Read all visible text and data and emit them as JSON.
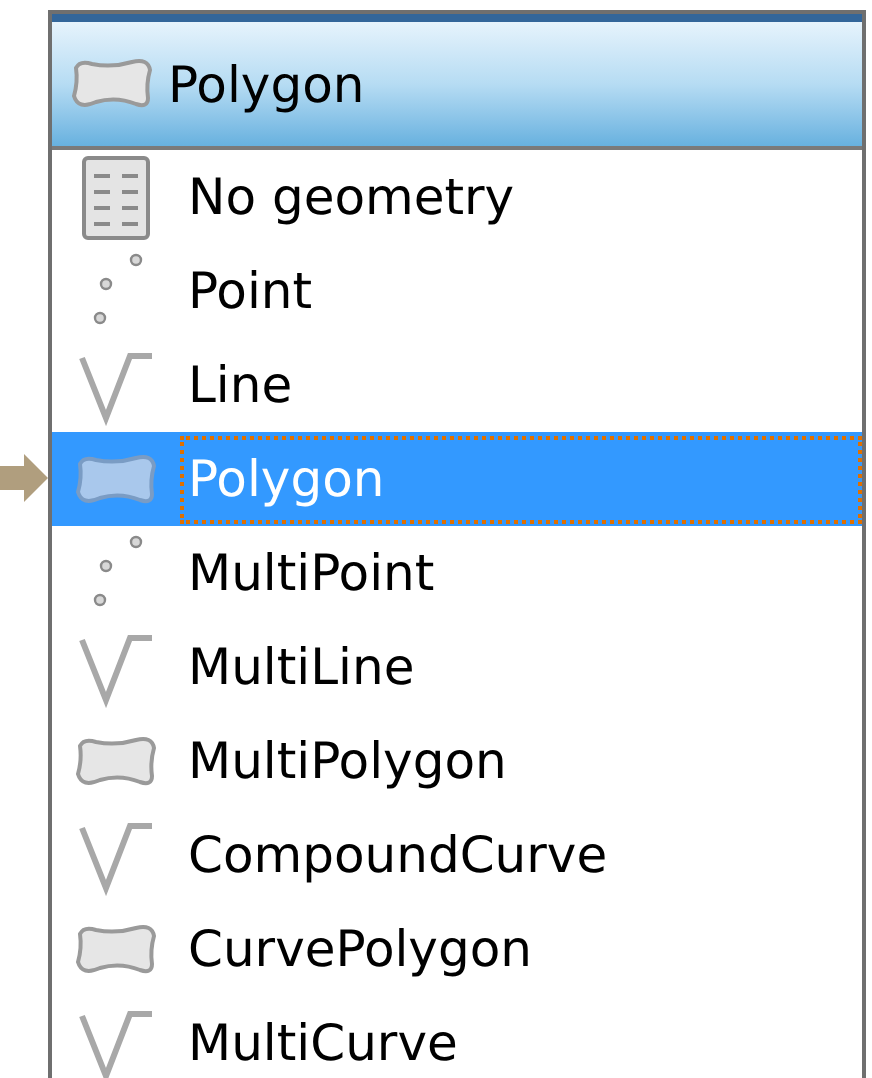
{
  "combo": {
    "value": "Polygon",
    "kind": "polygon"
  },
  "items": [
    {
      "label": "No geometry",
      "kind": "table",
      "selected": false
    },
    {
      "label": "Point",
      "kind": "points",
      "selected": false
    },
    {
      "label": "Line",
      "kind": "line",
      "selected": false
    },
    {
      "label": "Polygon",
      "kind": "polygon",
      "selected": true
    },
    {
      "label": "MultiPoint",
      "kind": "points",
      "selected": false
    },
    {
      "label": "MultiLine",
      "kind": "line",
      "selected": false
    },
    {
      "label": "MultiPolygon",
      "kind": "polygon",
      "selected": false
    },
    {
      "label": "CompoundCurve",
      "kind": "line",
      "selected": false
    },
    {
      "label": "CurvePolygon",
      "kind": "polygon",
      "selected": false
    },
    {
      "label": "MultiCurve",
      "kind": "line",
      "selected": false
    }
  ]
}
